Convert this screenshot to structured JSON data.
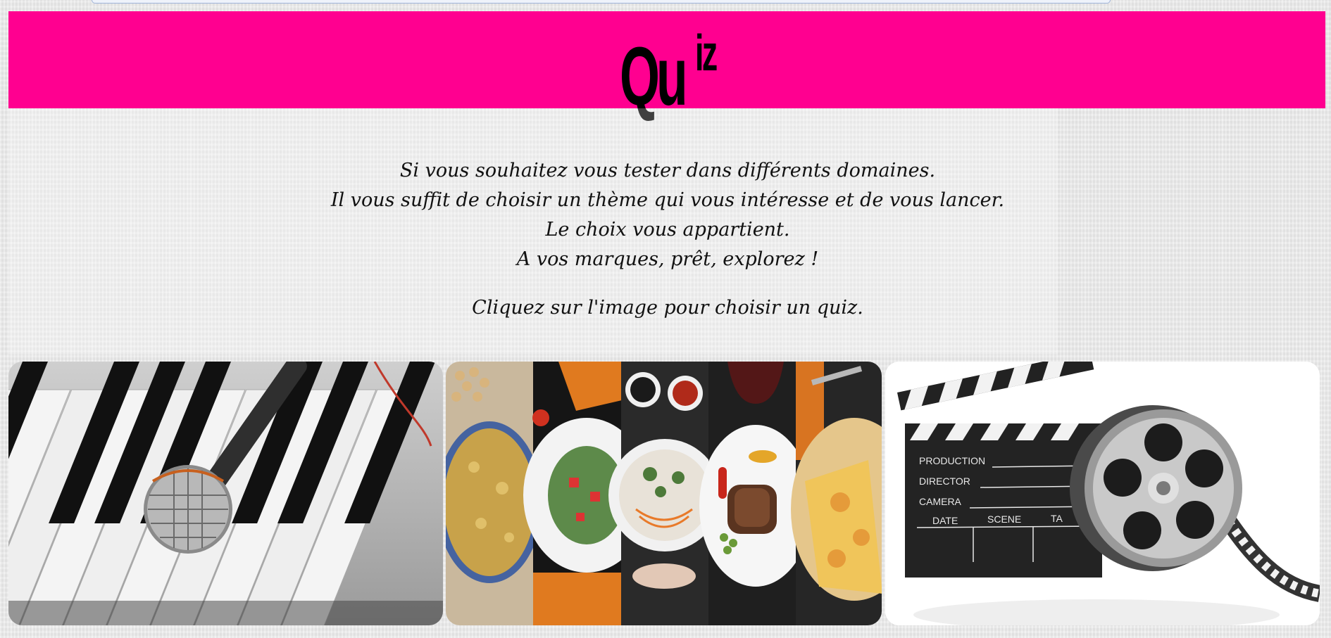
{
  "header": {
    "logo_main": "Qu",
    "logo_sup": "iz",
    "background": "#ff0090"
  },
  "intro": {
    "lines": [
      "Si vous souhaitez vous tester dans différents domaines.",
      "Il vous suffit de choisir un thème qui vous intéresse et de vous lancer.",
      "Le choix vous appartient.",
      "A vos marques, prêt, explorez !"
    ],
    "cta": "Cliquez sur l'image pour choisir un quiz."
  },
  "quizzes": [
    {
      "theme": "music",
      "image": "piano-microphone-image"
    },
    {
      "theme": "food",
      "image": "dishes-collage-image"
    },
    {
      "theme": "cinema",
      "image": "clapperboard-film-reel-image",
      "board_labels": [
        "PRODUCTION",
        "DIRECTOR",
        "CAMERA",
        "DATE",
        "SCENE",
        "TA"
      ]
    }
  ]
}
